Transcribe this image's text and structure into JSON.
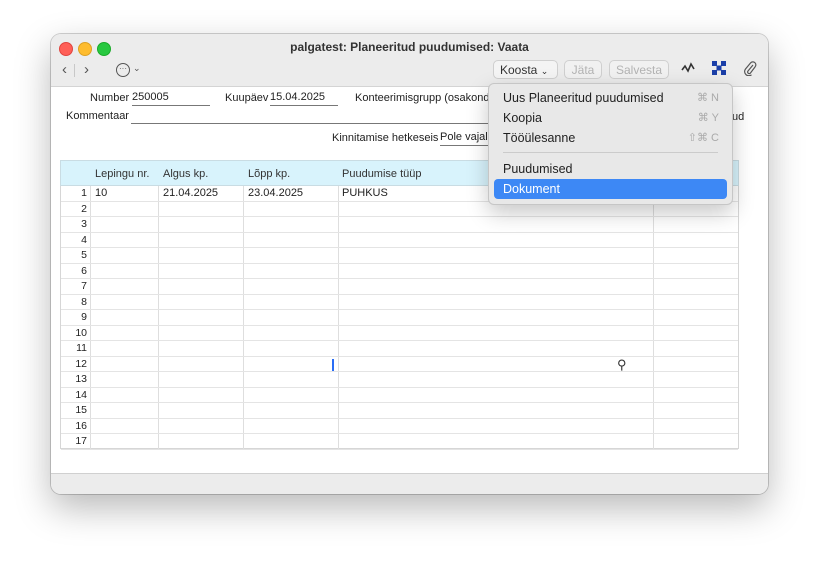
{
  "window": {
    "title": "palgatest: Planeeritud puudumised: Vaata"
  },
  "toolbar": {
    "back_icon": "chevron-left-icon",
    "forward_icon": "chevron-right-icon",
    "more_icon": "ellipsis-circle-icon",
    "koosta_label": "Koosta",
    "jata_label": "Jäta",
    "salvesta_label": "Salvesta",
    "activity_icon": "activity-icon",
    "grid_icon": "x-grid-icon",
    "attach_icon": "paperclip-icon"
  },
  "form": {
    "number_label": "Number",
    "number_value": "250005",
    "kuupaev_label": "Kuupäev",
    "kuupaev_value": "15.04.2025",
    "konteerimisgrupp_label": "Konteerimisgrupp (osakond",
    "kommentaar_label": "Kommentaar",
    "kommentaar_value": "",
    "kinnitamise_label": "Kinnitamise hetkeseis",
    "kinnitamise_value": "Pole vajali",
    "trailing_text": "ud"
  },
  "table": {
    "columns": [
      "Lepingu nr.",
      "Algus kp.",
      "Lõpp kp.",
      "Puudumise tüüp"
    ],
    "row_numbers": [
      "1",
      "2",
      "3",
      "4",
      "5",
      "6",
      "7",
      "8",
      "9",
      "10",
      "11",
      "12",
      "13",
      "14",
      "15",
      "16",
      "17"
    ],
    "rows": [
      {
        "lepingu": "10",
        "algus": "21.04.2025",
        "lopp": "23.04.2025",
        "tyyp": "PUHKUS"
      }
    ]
  },
  "menu": {
    "items": [
      {
        "label": "Uus Planeeritud puudumised",
        "shortcut": "⌘ N"
      },
      {
        "label": "Koopia",
        "shortcut": "⌘ Y"
      },
      {
        "label": "Tööülesanne",
        "shortcut": "⇧⌘ C"
      },
      {
        "label": "Puudumised",
        "shortcut": ""
      },
      {
        "label": "Dokument",
        "shortcut": ""
      }
    ],
    "selected": "Dokument"
  },
  "colors": {
    "header_bg": "#d8f3fc",
    "menu_selection": "#3d88f5",
    "grid_icon": "#1b3fa8"
  }
}
